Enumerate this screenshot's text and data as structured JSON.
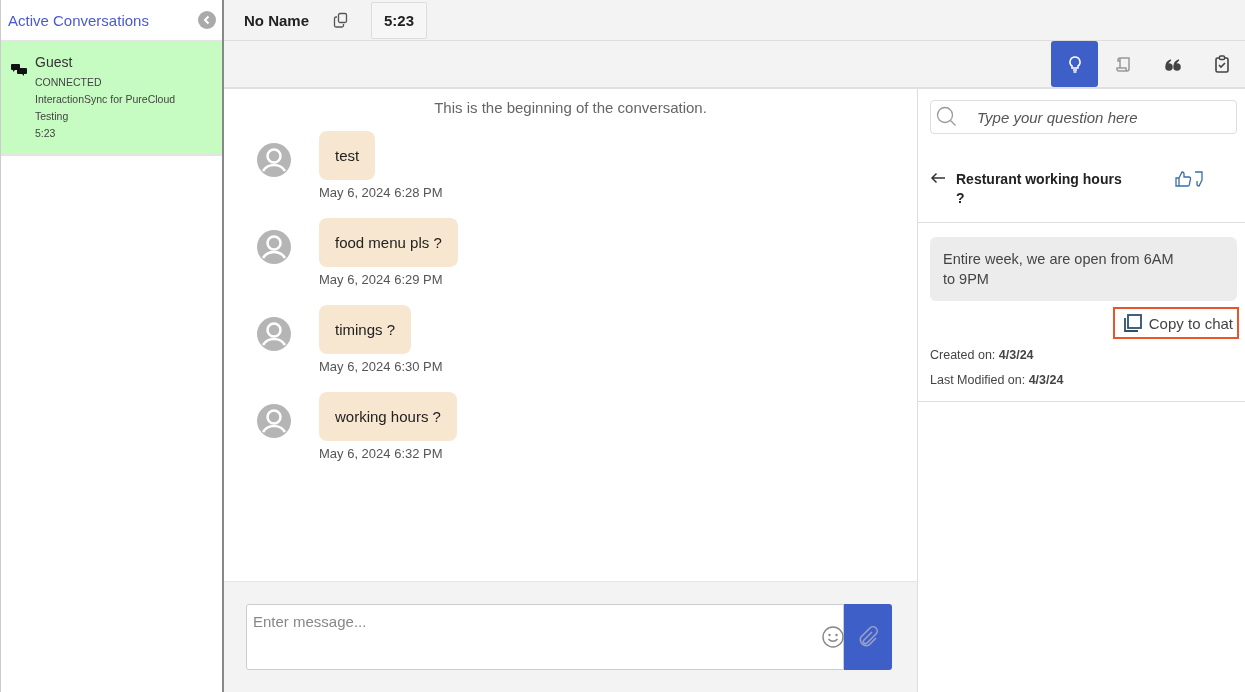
{
  "sidebar": {
    "title": "Active Conversations",
    "items": [
      {
        "name": "Guest",
        "status": "CONNECTED",
        "queue": "InteractionSync for PureCloud Testing",
        "time": "5:23",
        "selected": true
      }
    ]
  },
  "header": {
    "name": "No Name",
    "timer": "5:23"
  },
  "tabs": [
    {
      "kind": "bulb",
      "selected": true
    },
    {
      "kind": "script",
      "selected": false
    },
    {
      "kind": "quote",
      "selected": false
    },
    {
      "kind": "clipboard",
      "selected": false
    }
  ],
  "chat": {
    "intro": "This is the beginning of the conversation.",
    "messages": [
      {
        "text": "test",
        "time": "May 6, 2024 6:28 PM"
      },
      {
        "text": "food menu pls ?",
        "time": "May 6, 2024 6:29 PM"
      },
      {
        "text": "timings ?",
        "time": "May 6, 2024 6:30 PM"
      },
      {
        "text": "working hours ?",
        "time": "May 6, 2024 6:32 PM"
      }
    ],
    "input": {
      "placeholder": "Enter message..."
    }
  },
  "knowledge": {
    "search": {
      "placeholder": "Type your question here"
    },
    "question": "Resturant working hours ?",
    "answer": "Entire week, we are open from 6AM to 9PM",
    "copy": {
      "label": "Copy to chat",
      "focused": true
    },
    "created": "Created on: **4/3/24**",
    "modified": "Last Modified on: **4/3/24**"
  }
}
